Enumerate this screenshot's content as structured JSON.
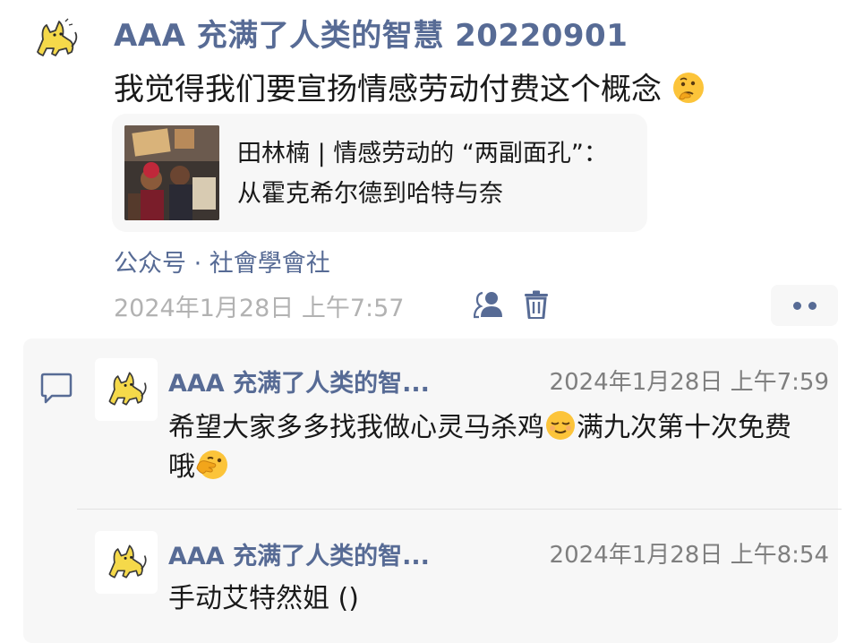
{
  "post": {
    "author": "AAA 充满了人类的智慧 20220901",
    "text": "我觉得我们要宣扬情感劳动付费这个概念",
    "text_emoji": "thinking-face-emoji",
    "link": {
      "title": "田林楠 | 情感劳动的 “两副面孔”：从霍克希尔德到哈特与奈"
    },
    "source": "公众号 · 社會學會社",
    "time": "2024年1月28日 上午7:57"
  },
  "comments": [
    {
      "author": "AAA 充满了人类的智...",
      "time": "2024年1月28日 上午7:59",
      "text_part1": "希望大家多多找我做心灵马杀鸡",
      "text_part2": "满九次第十次免费哦",
      "emoji1": "relieved-face-emoji",
      "emoji2": "face-with-hand-over-mouth-emoji"
    },
    {
      "author": "AAA 充满了人类的智...",
      "time": "2024年1月28日 上午8:54",
      "text": "手动艾特然姐 ()"
    }
  ],
  "colors": {
    "link_blue": "#576b95",
    "gray_text": "#b2b2b2",
    "panel_bg": "#f7f7f7",
    "cat_yellow": "#f5d94a"
  }
}
